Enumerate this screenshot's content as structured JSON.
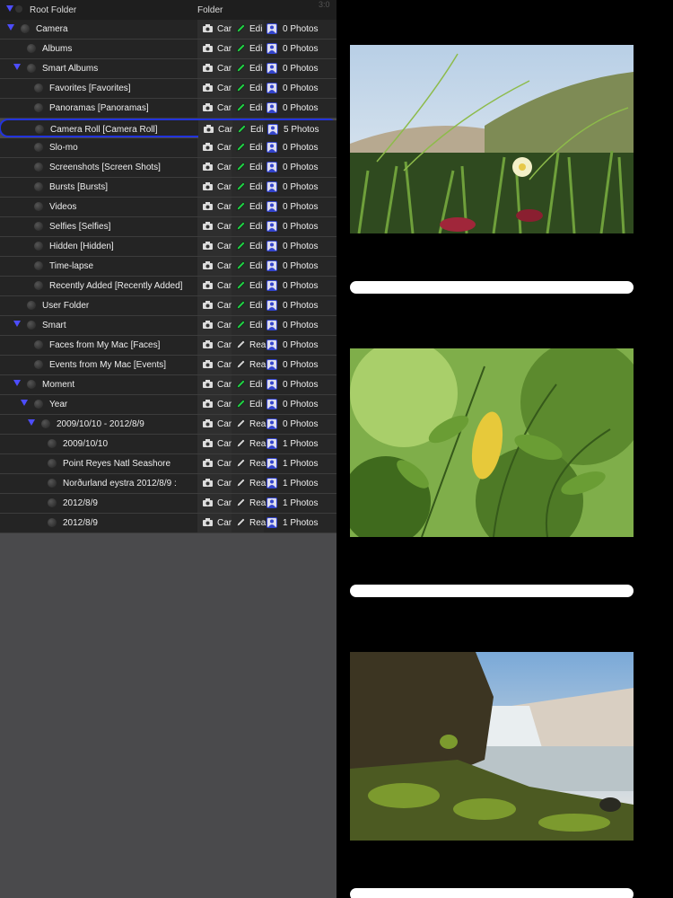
{
  "status_time": "3:0",
  "header": {
    "name": "Root Folder",
    "col_folder": "Folder"
  },
  "tree": [
    {
      "name": "Camera",
      "indent": 0,
      "expand": true,
      "cam": "Car",
      "edit": "Edi",
      "edit_type": "edit",
      "photos": "0 Photos"
    },
    {
      "name": "Albums",
      "indent": 1,
      "expand": false,
      "cam": "Car",
      "edit": "Edi",
      "edit_type": "edit",
      "photos": "0 Photos"
    },
    {
      "name": "Smart Albums",
      "indent": 1,
      "expand": true,
      "cam": "Car",
      "edit": "Edi",
      "edit_type": "edit",
      "photos": "0 Photos"
    },
    {
      "name": "Favorites  [Favorites]",
      "indent": 2,
      "expand": false,
      "cam": "Car",
      "edit": "Edi",
      "edit_type": "edit",
      "photos": "0 Photos"
    },
    {
      "name": "Panoramas  [Panoramas]",
      "indent": 2,
      "expand": false,
      "cam": "Car",
      "edit": "Edi",
      "edit_type": "edit",
      "photos": "0 Photos"
    },
    {
      "name": "Camera Roll  [Camera Roll]",
      "indent": 2,
      "expand": false,
      "cam": "Car",
      "edit": "Edi",
      "edit_type": "edit",
      "photos": "5 Photos",
      "selected": true
    },
    {
      "name": "Slo-mo",
      "indent": 2,
      "expand": false,
      "cam": "Car",
      "edit": "Edi",
      "edit_type": "edit",
      "photos": "0 Photos"
    },
    {
      "name": "Screenshots  [Screen Shots]",
      "indent": 2,
      "expand": false,
      "cam": "Car",
      "edit": "Edi",
      "edit_type": "edit",
      "photos": "0 Photos"
    },
    {
      "name": "Bursts  [Bursts]",
      "indent": 2,
      "expand": false,
      "cam": "Car",
      "edit": "Edi",
      "edit_type": "edit",
      "photos": "0 Photos"
    },
    {
      "name": "Videos",
      "indent": 2,
      "expand": false,
      "cam": "Car",
      "edit": "Edi",
      "edit_type": "edit",
      "photos": "0 Photos"
    },
    {
      "name": "Selfies  [Selfies]",
      "indent": 2,
      "expand": false,
      "cam": "Car",
      "edit": "Edi",
      "edit_type": "edit",
      "photos": "0 Photos"
    },
    {
      "name": "Hidden  [Hidden]",
      "indent": 2,
      "expand": false,
      "cam": "Car",
      "edit": "Edi",
      "edit_type": "edit",
      "photos": "0 Photos"
    },
    {
      "name": "Time-lapse",
      "indent": 2,
      "expand": false,
      "cam": "Car",
      "edit": "Edi",
      "edit_type": "edit",
      "photos": "0 Photos"
    },
    {
      "name": "Recently Added  [Recently Added]",
      "indent": 2,
      "expand": false,
      "cam": "Car",
      "edit": "Edi",
      "edit_type": "edit",
      "photos": "0 Photos"
    },
    {
      "name": "User Folder",
      "indent": 1,
      "expand": false,
      "cam": "Car",
      "edit": "Edi",
      "edit_type": "edit",
      "photos": "0 Photos"
    },
    {
      "name": "Smart",
      "indent": 1,
      "expand": true,
      "cam": "Car",
      "edit": "Edi",
      "edit_type": "edit",
      "photos": "0 Photos"
    },
    {
      "name": "Faces from My Mac  [Faces]",
      "indent": 2,
      "expand": false,
      "cam": "Car",
      "edit": "Rea",
      "edit_type": "read",
      "photos": "0 Photos"
    },
    {
      "name": "Events from My Mac  [Events]",
      "indent": 2,
      "expand": false,
      "cam": "Car",
      "edit": "Rea",
      "edit_type": "read",
      "photos": "0 Photos"
    },
    {
      "name": "Moment",
      "indent": 1,
      "expand": true,
      "cam": "Car",
      "edit": "Edi",
      "edit_type": "edit",
      "photos": "0 Photos"
    },
    {
      "name": "Year",
      "indent": 2,
      "expand": true,
      "cam": "Car",
      "edit": "Edi",
      "edit_type": "edit",
      "photos": "0 Photos"
    },
    {
      "name": "2009/10/10 - 2012/8/9",
      "indent": 3,
      "expand": true,
      "cam": "Car",
      "edit": "Rea",
      "edit_type": "read",
      "photos": "0 Photos"
    },
    {
      "name": "2009/10/10",
      "indent": 4,
      "expand": false,
      "cam": "Car",
      "edit": "Rea",
      "edit_type": "read",
      "photos": "1 Photos"
    },
    {
      "name": "Point Reyes Natl Seashore",
      "indent": 4,
      "expand": false,
      "cam": "Car",
      "edit": "Rea",
      "edit_type": "read",
      "photos": "1 Photos"
    },
    {
      "name": "Norðurland eystra  2012/8/9 :",
      "indent": 4,
      "expand": false,
      "cam": "Car",
      "edit": "Rea",
      "edit_type": "read",
      "photos": "1 Photos"
    },
    {
      "name": "2012/8/9",
      "indent": 4,
      "expand": false,
      "cam": "Car",
      "edit": "Rea",
      "edit_type": "read",
      "photos": "1 Photos"
    },
    {
      "name": "2012/8/9",
      "indent": 4,
      "expand": false,
      "cam": "Car",
      "edit": "Rea",
      "edit_type": "read",
      "photos": "1 Photos"
    }
  ],
  "viewer": {
    "photos": [
      {
        "name": "flower-dunes-photo"
      },
      {
        "name": "leaves-photo"
      },
      {
        "name": "waterfall-photo"
      }
    ]
  },
  "colors": {
    "expand_arrow": "#4d4dff",
    "edit_icon": "#22cc44",
    "selected_border": "#2233dd"
  }
}
